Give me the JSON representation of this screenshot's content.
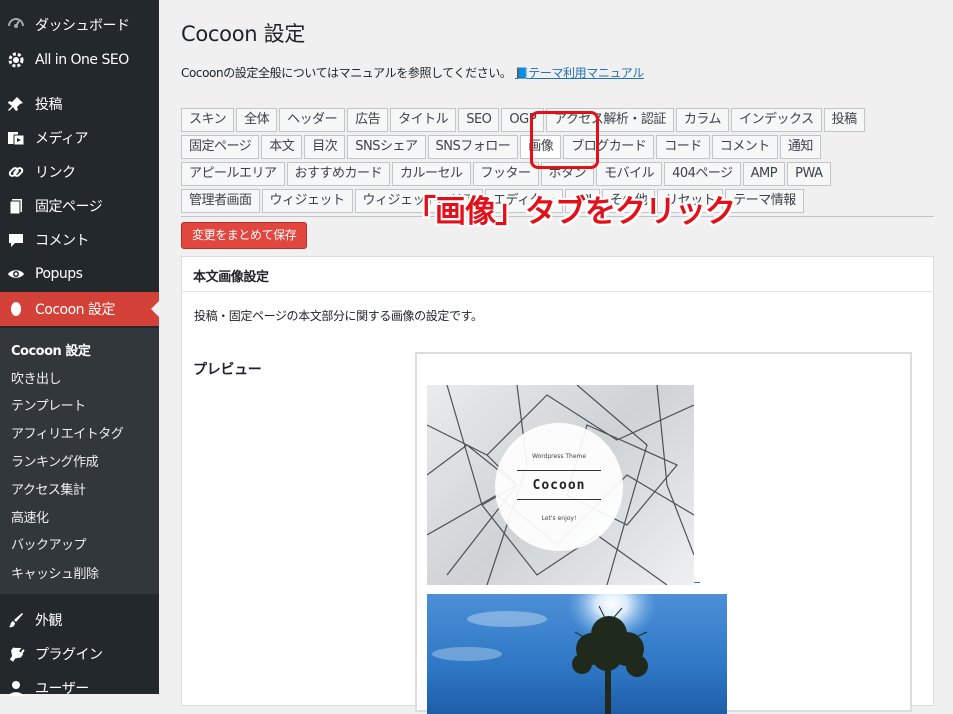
{
  "sidebar": {
    "top_items": [
      {
        "label": "ダッシュボード",
        "icon": "dashboard-icon"
      },
      {
        "label": "All in One SEO",
        "icon": "gear-icon"
      },
      {
        "label": "投稿",
        "icon": "pin-icon"
      },
      {
        "label": "メディア",
        "icon": "media-icon"
      },
      {
        "label": "リンク",
        "icon": "link-icon"
      },
      {
        "label": "固定ページ",
        "icon": "page-icon"
      },
      {
        "label": "コメント",
        "icon": "comment-icon"
      },
      {
        "label": "Popups",
        "icon": "eye-icon"
      },
      {
        "label": "Cocoon 設定",
        "icon": "circle-icon"
      }
    ],
    "submenu": [
      "Cocoon 設定",
      "吹き出し",
      "テンプレート",
      "アフィリエイトタグ",
      "ランキング作成",
      "アクセス集計",
      "高速化",
      "バックアップ",
      "キャッシュ削除"
    ],
    "bottom_items": [
      {
        "label": "外観",
        "icon": "brush-icon"
      },
      {
        "label": "プラグイン",
        "icon": "plugin-icon"
      },
      {
        "label": "ユーザー",
        "icon": "user-icon"
      }
    ]
  },
  "main": {
    "title": "Cocoon 設定",
    "intro": "Cocoonの設定全般についてはマニュアルを参照してください。",
    "manual_link": "テーマ利用マニュアル",
    "tabs": [
      [
        "スキン",
        "全体",
        "ヘッダー",
        "広告",
        "タイトル",
        "SEO",
        "OGP",
        "アクセス解析・認証",
        "カラム",
        "インデックス",
        "投稿"
      ],
      [
        "固定ページ",
        "本文",
        "目次",
        "SNSシェア",
        "SNSフォロー",
        "画像",
        "ブログカード",
        "コード",
        "コメント",
        "通知"
      ],
      [
        "アピールエリア",
        "おすすめカード",
        "カルーセル",
        "フッター",
        "ボタン",
        "モバイル",
        "404ページ",
        "AMP",
        "PWA"
      ],
      [
        "管理者画面",
        "ウィジェット",
        "ウィジェットエリア",
        "エディター",
        "API",
        "その他",
        "リセット",
        "テーマ情報"
      ]
    ],
    "active_tab": "画像",
    "annotation": "「画像」タブをクリック",
    "save_button": "変更をまとめて保存",
    "panel": {
      "title": "本文画像設定",
      "description": "投稿・固定ページの本文部分に関する画像の設定です。",
      "preview_label": "プレビュー",
      "badge": {
        "small_top": "Wordpress Theme",
        "main": "Cocoon",
        "small_bottom": "Let's enjoy!"
      }
    }
  },
  "colors": {
    "sidebar_bg": "#23282d",
    "submenu_bg": "#32373c",
    "active": "#d44138",
    "annotation": "#e3101a",
    "link": "#2271b1"
  }
}
